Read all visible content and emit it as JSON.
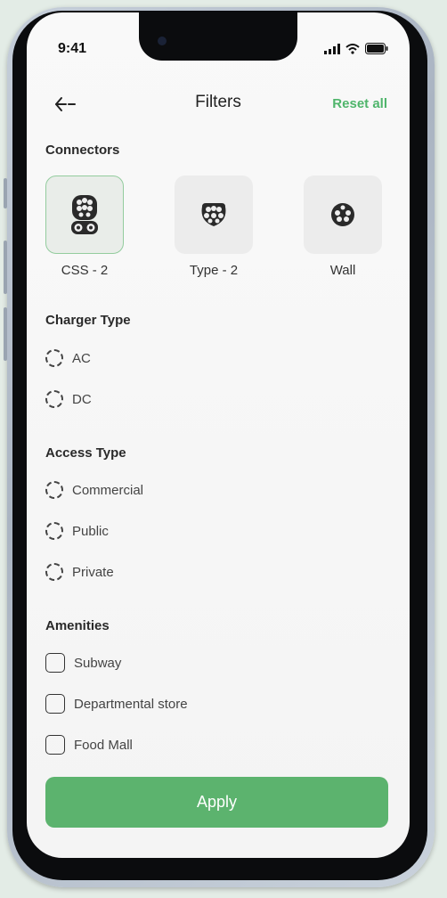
{
  "status_bar": {
    "time": "9:41"
  },
  "header": {
    "title": "Filters",
    "reset_label": "Reset all"
  },
  "connectors": {
    "title": "Connectors",
    "items": [
      {
        "label": "CSS - 2",
        "selected": true,
        "icon": "ccs2-connector-icon"
      },
      {
        "label": "Type - 2",
        "selected": false,
        "icon": "type2-connector-icon"
      },
      {
        "label": "Wall",
        "selected": false,
        "icon": "wall-connector-icon"
      }
    ]
  },
  "charger_type": {
    "title": "Charger Type",
    "options": [
      {
        "label": "AC"
      },
      {
        "label": "DC"
      }
    ]
  },
  "access_type": {
    "title": "Access Type",
    "options": [
      {
        "label": "Commercial"
      },
      {
        "label": "Public"
      },
      {
        "label": "Private"
      }
    ]
  },
  "amenities": {
    "title": "Amenities",
    "options": [
      {
        "label": "Subway"
      },
      {
        "label": "Departmental store"
      },
      {
        "label": "Food Mall"
      }
    ]
  },
  "apply_label": "Apply",
  "colors": {
    "accent": "#5cb36e",
    "link": "#4fb56b",
    "selected_border": "#93cc9e"
  }
}
